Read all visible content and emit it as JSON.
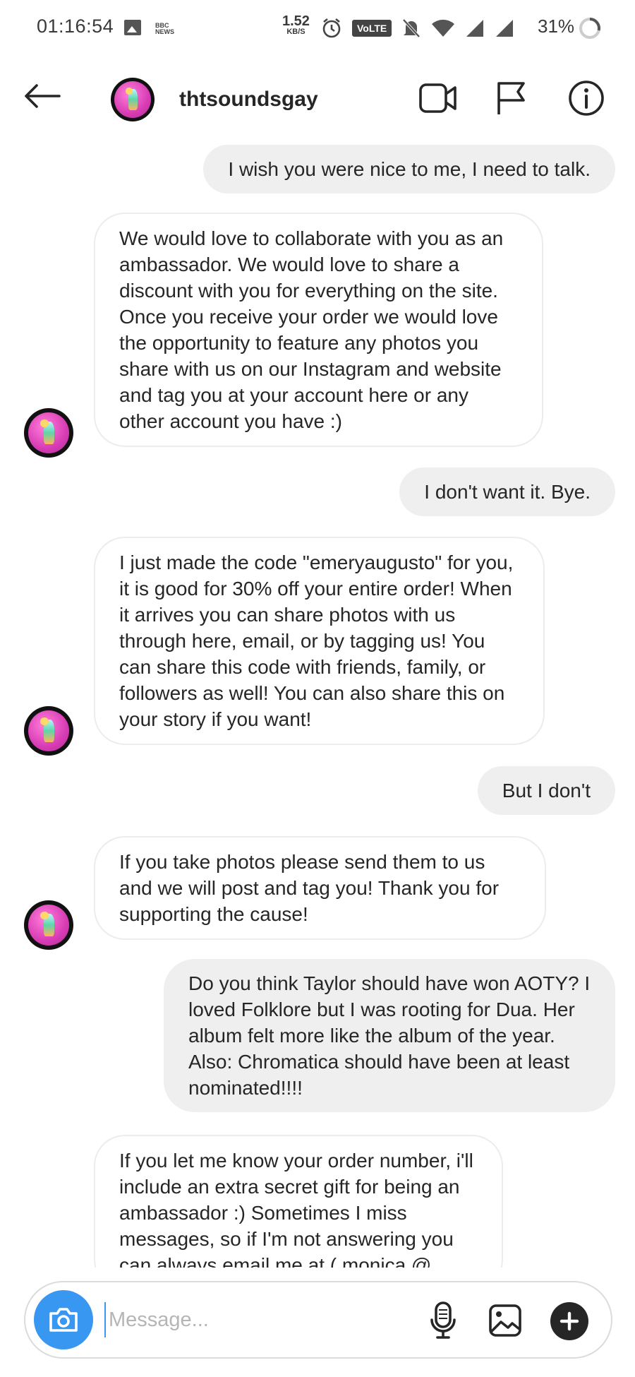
{
  "status_bar": {
    "time": "01:16:54",
    "bbc_label": "BBC NEWS",
    "net_speed_value": "1.52",
    "net_speed_unit": "KB/S",
    "volte_label": "VoLTE",
    "battery": "31%"
  },
  "header": {
    "username": "thtsoundsgay",
    "icons": [
      "back-arrow-icon",
      "video-call-icon",
      "flag-icon",
      "info-icon"
    ]
  },
  "messages": [
    {
      "direction": "out",
      "text": "I wish you were nice to me, I need to talk."
    },
    {
      "direction": "in",
      "text": "We would love to collaborate with you as an ambassador. We would love to share a discount with you for everything on the site. Once you receive your order we would love the opportunity to feature any photos you share with us on our Instagram and website and tag you at your account here or any other account you have :)"
    },
    {
      "direction": "out",
      "text": "I don't want it. Bye."
    },
    {
      "direction": "in",
      "text": "I just made the code \"emeryaugusto\" for you, it is good for 30% off your entire order! When it arrives you can share photos with us through here, email, or by tagging us! You can share this code with friends, family, or followers as well! You can also share this on your story if you want!"
    },
    {
      "direction": "out",
      "text": "But I don't"
    },
    {
      "direction": "in",
      "text": "If you take photos please send them to us and we will post and tag you! Thank you for supporting the cause!"
    },
    {
      "direction": "out",
      "text": "Do you think Taylor should have won AOTY? I loved Folklore but I was rooting for Dua. Her album felt more like the album of the year. Also: Chromatica should have been at least nominated!!!!"
    },
    {
      "direction": "in",
      "text": "If you let me know your order number, i'll include an extra secret gift for being an ambassador :) Sometimes I miss messages, so if I'm not answering you can always email me at ( monica @"
    }
  ],
  "composer": {
    "placeholder": "Message..."
  },
  "colors": {
    "accent": "#3897f0",
    "outgoing_bubble": "#efefef",
    "text": "#262626"
  }
}
